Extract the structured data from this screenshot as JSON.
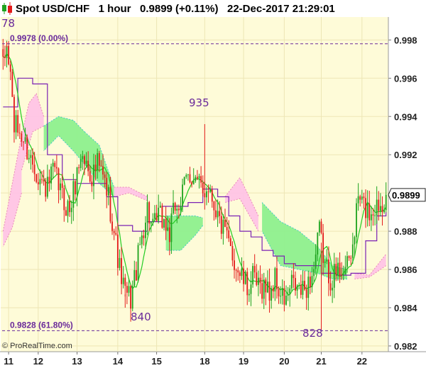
{
  "header": {
    "title": "Spot USD/CHF   1 hour   0.9899 (+0.11%)   22-Dec-2017 21:29:01",
    "icon": "candlestick-icon"
  },
  "copyright": "© ProRealTime.com",
  "colors": {
    "bull": "#1fa31f",
    "bear": "#e31b1b",
    "kijun": "#7b22b3",
    "tenkan": "#22cc22",
    "cloud_green": "#8ef08e",
    "cloud_pink": "#ffc4e6",
    "bg": "#fefbd8",
    "fibo": "#6a2a9a"
  },
  "annotations": [
    {
      "text": "78"
    },
    {
      "text": "935"
    },
    {
      "text": "840"
    },
    {
      "text": "828"
    }
  ],
  "chart_data": {
    "type": "candlestick",
    "title": "Spot USD/CHF",
    "timeframe": "1 hour",
    "last_price": "0.9899",
    "change": "(+0.11%)",
    "timestamp": "22-Dec-2017 21:29:01",
    "ylim": [
      0.9817,
      0.9992
    ],
    "y_ticks": [
      "0.998",
      "0.996",
      "0.994",
      "0.992",
      "0.990",
      "0.988",
      "0.986",
      "0.984",
      "0.982"
    ],
    "x_ticks": [
      "11",
      "12",
      "13",
      "14",
      "15",
      "18",
      "19",
      "20",
      "21",
      "22"
    ],
    "x_tick_index": [
      3,
      19,
      40,
      62,
      83,
      109,
      130,
      152,
      172,
      194
    ],
    "bars_count": 208,
    "fib_levels": [
      {
        "price": 0.9978,
        "label": "0.9978 (0.00%)"
      },
      {
        "price": 0.9828,
        "label": "0.9828 (61.80%)"
      }
    ],
    "anchors": [
      [
        0,
        0.9965
      ],
      [
        2,
        0.9976
      ],
      [
        4,
        0.9962
      ],
      [
        6,
        0.9935
      ],
      [
        9,
        0.9932
      ],
      [
        12,
        0.9925
      ],
      [
        15,
        0.9918
      ],
      [
        18,
        0.9912
      ],
      [
        21,
        0.9905
      ],
      [
        24,
        0.9902
      ],
      [
        27,
        0.9911
      ],
      [
        30,
        0.9904
      ],
      [
        33,
        0.9895
      ],
      [
        36,
        0.9891
      ],
      [
        39,
        0.9905
      ],
      [
        42,
        0.992
      ],
      [
        45,
        0.9915
      ],
      [
        48,
        0.9909
      ],
      [
        51,
        0.9915
      ],
      [
        54,
        0.9908
      ],
      [
        57,
        0.9898
      ],
      [
        60,
        0.988
      ],
      [
        63,
        0.986
      ],
      [
        66,
        0.9847
      ],
      [
        69,
        0.9845
      ],
      [
        72,
        0.986
      ],
      [
        75,
        0.9878
      ],
      [
        78,
        0.9892
      ],
      [
        81,
        0.988
      ],
      [
        84,
        0.9888
      ],
      [
        87,
        0.9885
      ],
      [
        90,
        0.9878
      ],
      [
        93,
        0.9893
      ],
      [
        96,
        0.9895
      ],
      [
        99,
        0.9907
      ],
      [
        102,
        0.991
      ],
      [
        105,
        0.9905
      ],
      [
        108,
        0.99
      ],
      [
        111,
        0.9905
      ],
      [
        114,
        0.9895
      ],
      [
        117,
        0.9885
      ],
      [
        120,
        0.9878
      ],
      [
        123,
        0.987
      ],
      [
        126,
        0.9862
      ],
      [
        129,
        0.9856
      ],
      [
        132,
        0.985
      ],
      [
        135,
        0.9855
      ],
      [
        138,
        0.985
      ],
      [
        141,
        0.9852
      ],
      [
        144,
        0.9848
      ],
      [
        147,
        0.9855
      ],
      [
        150,
        0.9846
      ],
      [
        153,
        0.9843
      ],
      [
        156,
        0.9852
      ],
      [
        159,
        0.985
      ],
      [
        162,
        0.9848
      ],
      [
        165,
        0.9853
      ],
      [
        168,
        0.986
      ],
      [
        171,
        0.988
      ],
      [
        174,
        0.9862
      ],
      [
        177,
        0.9856
      ],
      [
        180,
        0.9858
      ],
      [
        183,
        0.9862
      ],
      [
        186,
        0.986
      ],
      [
        189,
        0.9872
      ],
      [
        192,
        0.9898
      ],
      [
        195,
        0.9893
      ],
      [
        198,
        0.989
      ],
      [
        201,
        0.9893
      ],
      [
        204,
        0.9895
      ],
      [
        207,
        0.9899
      ]
    ],
    "kijun": [
      [
        0,
        0.9945
      ],
      [
        8,
        0.996
      ],
      [
        16,
        0.9957
      ],
      [
        24,
        0.992
      ],
      [
        32,
        0.9907
      ],
      [
        40,
        0.9905
      ],
      [
        48,
        0.9905
      ],
      [
        56,
        0.9898
      ],
      [
        62,
        0.9883
      ],
      [
        70,
        0.988
      ],
      [
        78,
        0.9885
      ],
      [
        86,
        0.9893
      ],
      [
        94,
        0.9893
      ],
      [
        100,
        0.9895
      ],
      [
        108,
        0.9902
      ],
      [
        116,
        0.9898
      ],
      [
        122,
        0.9888
      ],
      [
        128,
        0.988
      ],
      [
        134,
        0.9877
      ],
      [
        140,
        0.987
      ],
      [
        146,
        0.9867
      ],
      [
        152,
        0.9863
      ],
      [
        158,
        0.9862
      ],
      [
        166,
        0.9862
      ],
      [
        172,
        0.9858
      ],
      [
        180,
        0.9857
      ],
      [
        188,
        0.9858
      ],
      [
        196,
        0.9875
      ],
      [
        202,
        0.9888
      ],
      [
        207,
        0.989
      ]
    ],
    "cloud_spans": [
      {
        "from": 0,
        "to": 10,
        "color": "pink",
        "top": [
          [
            0,
            0.988
          ],
          [
            4,
            0.99
          ],
          [
            7,
            0.9915
          ],
          [
            10,
            0.993
          ]
        ],
        "bottom": [
          [
            0,
            0.9872
          ],
          [
            5,
            0.9882
          ],
          [
            10,
            0.99
          ]
        ]
      },
      {
        "from": 10,
        "to": 22,
        "color": "pink",
        "top": [
          [
            10,
            0.993
          ],
          [
            14,
            0.9947
          ],
          [
            18,
            0.9952
          ],
          [
            22,
            0.994
          ]
        ],
        "bottom": [
          [
            10,
            0.9912
          ],
          [
            16,
            0.9932
          ],
          [
            22,
            0.9935
          ]
        ]
      },
      {
        "from": 22,
        "to": 44,
        "color": "green",
        "top": [
          [
            22,
            0.9935
          ],
          [
            30,
            0.994
          ],
          [
            38,
            0.9938
          ],
          [
            44,
            0.9932
          ]
        ],
        "bottom": [
          [
            22,
            0.9922
          ],
          [
            30,
            0.993
          ],
          [
            38,
            0.9922
          ],
          [
            44,
            0.9915
          ]
        ]
      },
      {
        "from": 44,
        "to": 60,
        "color": "green",
        "top": [
          [
            44,
            0.9932
          ],
          [
            52,
            0.9925
          ],
          [
            60,
            0.9903
          ]
        ],
        "bottom": [
          [
            44,
            0.9915
          ],
          [
            52,
            0.9905
          ],
          [
            60,
            0.9898
          ]
        ]
      },
      {
        "from": 60,
        "to": 78,
        "color": "pink",
        "top": [
          [
            60,
            0.9903
          ],
          [
            68,
            0.9903
          ],
          [
            78,
            0.9898
          ]
        ],
        "bottom": [
          [
            60,
            0.9898
          ],
          [
            68,
            0.99
          ],
          [
            78,
            0.9896
          ]
        ]
      },
      {
        "from": 88,
        "to": 108,
        "color": "green",
        "top": [
          [
            88,
            0.9888
          ],
          [
            96,
            0.9888
          ],
          [
            104,
            0.9888
          ],
          [
            108,
            0.9887
          ]
        ],
        "bottom": [
          [
            88,
            0.987
          ],
          [
            96,
            0.987
          ],
          [
            104,
            0.9878
          ],
          [
            108,
            0.9883
          ]
        ]
      },
      {
        "from": 120,
        "to": 138,
        "color": "pink",
        "top": [
          [
            120,
            0.9898
          ],
          [
            128,
            0.9908
          ],
          [
            138,
            0.9888
          ]
        ],
        "bottom": [
          [
            120,
            0.9895
          ],
          [
            128,
            0.9897
          ],
          [
            138,
            0.988
          ]
        ]
      },
      {
        "from": 140,
        "to": 170,
        "color": "green",
        "top": [
          [
            140,
            0.9895
          ],
          [
            150,
            0.9885
          ],
          [
            160,
            0.988
          ],
          [
            170,
            0.9872
          ]
        ],
        "bottom": [
          [
            140,
            0.988
          ],
          [
            150,
            0.9862
          ],
          [
            160,
            0.986
          ],
          [
            170,
            0.9858
          ]
        ]
      },
      {
        "from": 170,
        "to": 186,
        "color": "green",
        "top": [
          [
            170,
            0.9872
          ],
          [
            178,
            0.9862
          ],
          [
            186,
            0.986
          ]
        ],
        "bottom": [
          [
            170,
            0.9858
          ],
          [
            178,
            0.9855
          ],
          [
            186,
            0.9855
          ]
        ]
      },
      {
        "from": 190,
        "to": 207,
        "color": "pink",
        "top": [
          [
            190,
            0.9858
          ],
          [
            198,
            0.9857
          ],
          [
            207,
            0.9868
          ]
        ],
        "bottom": [
          [
            190,
            0.9855
          ],
          [
            198,
            0.9856
          ],
          [
            207,
            0.9862
          ]
        ]
      }
    ]
  }
}
